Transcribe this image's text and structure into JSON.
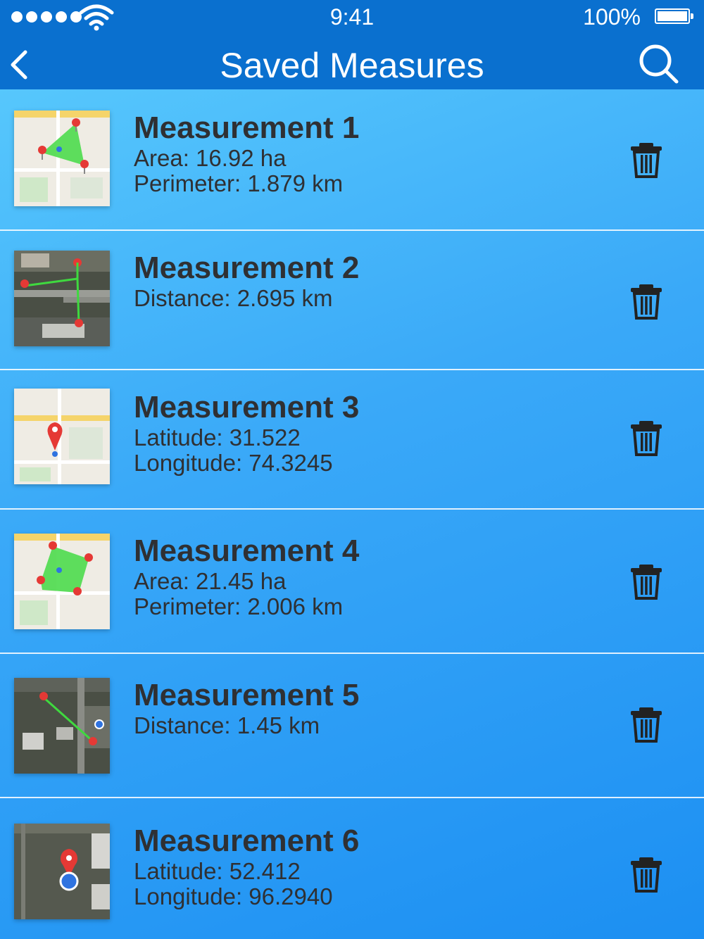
{
  "status_bar": {
    "time": "9:41",
    "battery": "100%"
  },
  "nav": {
    "title": "Saved Measures"
  },
  "items": [
    {
      "name": "Measurement 1",
      "line1": "Area: 16.92 ha",
      "line2": "Perimeter: 1.879 km"
    },
    {
      "name": "Measurement 2",
      "line1": "Distance: 2.695 km",
      "line2": ""
    },
    {
      "name": "Measurement 3",
      "line1": "Latitude: 31.522",
      "line2": "Longitude: 74.3245"
    },
    {
      "name": "Measurement 4",
      "line1": "Area: 21.45 ha",
      "line2": "Perimeter: 2.006 km"
    },
    {
      "name": "Measurement 5",
      "line1": "Distance: 1.45 km",
      "line2": ""
    },
    {
      "name": "Measurement 6",
      "line1": "Latitude: 52.412",
      "line2": "Longitude: 96.2940"
    }
  ]
}
